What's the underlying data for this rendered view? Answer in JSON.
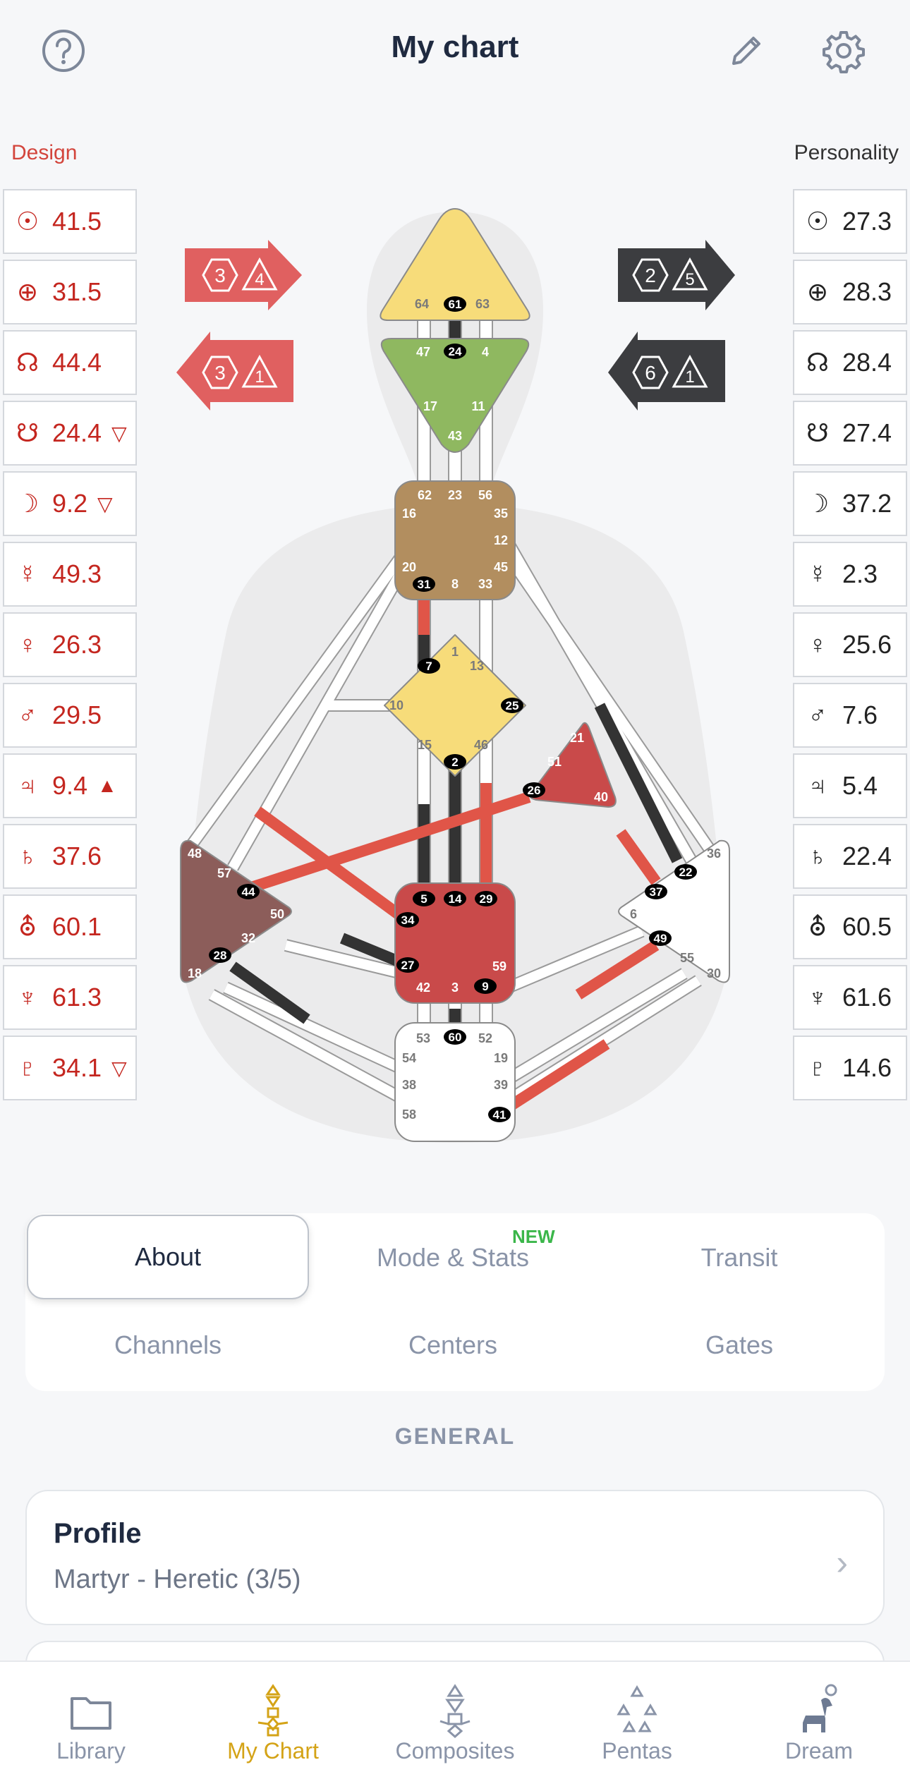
{
  "header": {
    "title": "My chart",
    "help_icon": "help-icon",
    "edit_icon": "pencil-icon",
    "settings_icon": "gear-icon"
  },
  "design": {
    "label": "Design",
    "color": "#d3453c",
    "planets": [
      {
        "symbol": "☉",
        "value": "41.5",
        "marker": ""
      },
      {
        "symbol": "⊕",
        "value": "31.5",
        "marker": ""
      },
      {
        "symbol": "☊",
        "value": "44.4",
        "marker": ""
      },
      {
        "symbol": "☋",
        "value": "24.4",
        "marker": "▽"
      },
      {
        "symbol": "☽",
        "value": "9.2",
        "marker": "▽"
      },
      {
        "symbol": "☿",
        "value": "49.3",
        "marker": ""
      },
      {
        "symbol": "♀",
        "value": "26.3",
        "marker": ""
      },
      {
        "symbol": "♂",
        "value": "29.5",
        "marker": ""
      },
      {
        "symbol": "♃",
        "value": "9.4",
        "marker": "▲"
      },
      {
        "symbol": "♄",
        "value": "37.6",
        "marker": ""
      },
      {
        "symbol": "⛢",
        "value": "60.1",
        "marker": ""
      },
      {
        "symbol": "♆",
        "value": "61.3",
        "marker": ""
      },
      {
        "symbol": "♇",
        "value": "34.1",
        "marker": "▽"
      }
    ],
    "arrows": [
      {
        "a": "3",
        "b": "4",
        "dir": "right"
      },
      {
        "a": "3",
        "b": "1",
        "dir": "left"
      }
    ]
  },
  "personality": {
    "label": "Personality",
    "planets": [
      {
        "symbol": "☉",
        "value": "27.3"
      },
      {
        "symbol": "⊕",
        "value": "28.3"
      },
      {
        "symbol": "☊",
        "value": "28.4"
      },
      {
        "symbol": "☋",
        "value": "27.4"
      },
      {
        "symbol": "☽",
        "value": "37.2"
      },
      {
        "symbol": "☿",
        "value": "2.3"
      },
      {
        "symbol": "♀",
        "value": "25.6"
      },
      {
        "symbol": "♂",
        "value": "7.6"
      },
      {
        "symbol": "♃",
        "value": "5.4"
      },
      {
        "symbol": "♄",
        "value": "22.4"
      },
      {
        "symbol": "⛢",
        "value": "60.5"
      },
      {
        "symbol": "♆",
        "value": "61.6"
      },
      {
        "symbol": "♇",
        "value": "14.6"
      }
    ],
    "arrows": [
      {
        "a": "2",
        "b": "5",
        "dir": "right"
      },
      {
        "a": "6",
        "b": "1",
        "dir": "left"
      }
    ]
  },
  "bodygraph": {
    "head": {
      "gates": [
        "64",
        "61",
        "63"
      ],
      "active": [
        "61"
      ],
      "color": "#f7dc7a"
    },
    "ajna": {
      "gates": [
        "47",
        "24",
        "4",
        "17",
        "11",
        "43"
      ],
      "active": [
        "24"
      ],
      "color": "#8fb860"
    },
    "throat": {
      "gates": [
        "62",
        "23",
        "56",
        "16",
        "35",
        "12",
        "20",
        "45",
        "31",
        "8",
        "33"
      ],
      "active": [
        "31"
      ],
      "color": "#b28e5f"
    },
    "g": {
      "gates": [
        "1",
        "13",
        "7",
        "10",
        "25",
        "15",
        "46",
        "2"
      ],
      "active": [
        "7",
        "25",
        "2"
      ],
      "color": "#f7dc7a"
    },
    "heart": {
      "gates": [
        "21",
        "51",
        "26",
        "40"
      ],
      "active": [
        "26"
      ],
      "color": "#c94a4a"
    },
    "spleen": {
      "gates": [
        "48",
        "57",
        "44",
        "50",
        "32",
        "28",
        "18"
      ],
      "active": [
        "44",
        "28"
      ],
      "color": "#8c5d5a"
    },
    "sacral": {
      "gates": [
        "5",
        "14",
        "29",
        "34",
        "27",
        "59",
        "42",
        "3",
        "9"
      ],
      "active": [
        "5",
        "14",
        "29",
        "34",
        "27",
        "9"
      ],
      "color": "#c94a4a"
    },
    "solar": {
      "gates": [
        "36",
        "22",
        "37",
        "6",
        "49",
        "55",
        "30"
      ],
      "active": [
        "22",
        "37",
        "49"
      ],
      "color": "#ffffff"
    },
    "root": {
      "gates": [
        "53",
        "60",
        "52",
        "54",
        "19",
        "38",
        "39",
        "58",
        "41"
      ],
      "active": [
        "60",
        "41"
      ],
      "color": "#ffffff"
    }
  },
  "tabs": {
    "about": "About",
    "mode_stats": "Mode & Stats",
    "new_badge": "NEW",
    "transit": "Transit",
    "channels": "Channels",
    "centers": "Centers",
    "gates": "Gates"
  },
  "section": {
    "general": "GENERAL"
  },
  "profile_card": {
    "title": "Profile",
    "subtitle": "Martyr - Heretic (3/5)"
  },
  "bottom_nav": [
    {
      "label": "Library",
      "icon": "folder-icon"
    },
    {
      "label": "My Chart",
      "icon": "bodygraph-icon"
    },
    {
      "label": "Composites",
      "icon": "composites-icon"
    },
    {
      "label": "Pentas",
      "icon": "pentas-icon"
    },
    {
      "label": "Dream",
      "icon": "dog-icon"
    }
  ]
}
